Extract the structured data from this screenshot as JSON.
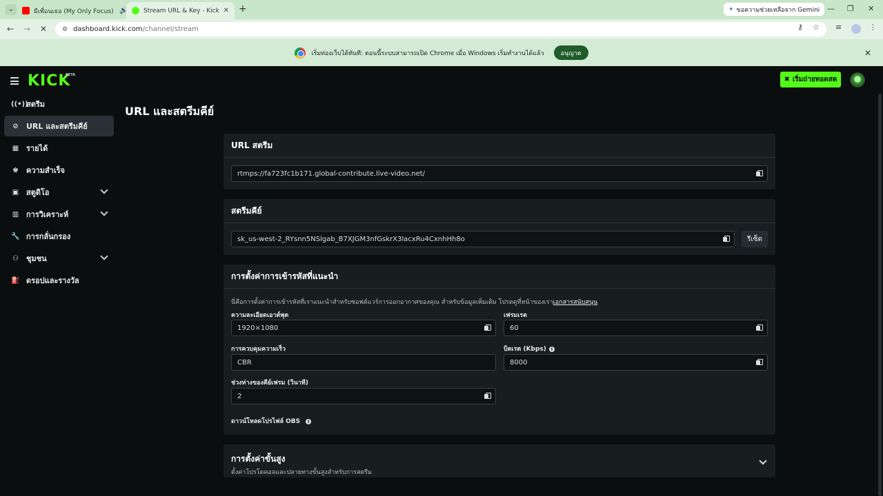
{
  "browser": {
    "tabs": [
      {
        "title": "มีเพื่อนเธอ (My Only Focus) O"
      },
      {
        "title": "Stream URL & Key - Kick Dashb"
      }
    ],
    "gemini_label": "ขอความช่วยเหลือจาก Gemini",
    "url_host": "dashboard.kick.com",
    "url_path": "/channel/stream",
    "infobar_text": "เริ่มท่องเว็บได้ทันที: ตอนนี้ระบบสามารถเปิด Chrome เมื่อ Windows เริ่มทำงานได้แล้ว",
    "infobar_button": "อนุญาต"
  },
  "app": {
    "logo": "KICK",
    "beta": "BETA",
    "go_live": "เริ่มถ่ายทอดสด"
  },
  "sidebar": {
    "items": [
      {
        "label": "สตรีม",
        "icon": "broadcast-icon"
      },
      {
        "label": "URL และสตรีมคีย์",
        "icon": "link-icon"
      },
      {
        "label": "รายได้",
        "icon": "revenue-icon"
      },
      {
        "label": "ความสำเร็จ",
        "icon": "trophy-icon"
      },
      {
        "label": "สตูดิโอ",
        "icon": "studio-icon"
      },
      {
        "label": "การวิเคราะห์",
        "icon": "analytics-icon"
      },
      {
        "label": "การกลั่นกรอง",
        "icon": "wrench-icon"
      },
      {
        "label": "ชุมชน",
        "icon": "community-icon"
      },
      {
        "label": "ดรอปและรางวัล",
        "icon": "drops-icon"
      }
    ]
  },
  "main": {
    "title": "URL และสตรีมคีย์",
    "stream_url": {
      "heading": "URL สตรีม",
      "value": "rtmps://fa723fc1b171.global-contribute.live-video.net/"
    },
    "stream_key": {
      "heading": "สตรีมคีย์",
      "value": "sk_us-west-2_RYsnn5NSlgab_B7XJGM3nfGskrX3lacxRu4CxnhHh8o",
      "reset": "รีเซ็ต"
    },
    "encoder": {
      "heading": "การตั้งค่าการเข้ารหัสที่แนะนำ",
      "description": "นี่คือการตั้งค่าการเข้ารหัสที่เราแนะนำสำหรับซอฟต์แวร์การออกอากาศของคุณ สำหรับข้อมูลเพิ่มเติม โปรดดูที่หน้าของเรา",
      "description_link": "เอกสารสนับสนุน",
      "resolution_label": "ความละเอียดเอาต์พุต",
      "resolution_value": "1920×1080",
      "framerate_label": "เฟรมเรต",
      "framerate_value": "60",
      "rate_control_label": "การควบคุมความเร็ว",
      "rate_control_value": "CBR",
      "bitrate_label": "บิตเรต (Kbps)",
      "bitrate_value": "8000",
      "keyframe_label": "ช่วงห่างของคีย์เฟรม (วินาที)",
      "keyframe_value": "2",
      "obs_profile": "ดาวน์โหลดโปรไฟล์ OBS"
    },
    "advanced": {
      "heading": "การตั้งค่าขั้นสูง",
      "subtitle": "ตั้งค่าโปรโตคอลและปลายทางขั้นสูงสำหรับการสตรีม"
    }
  }
}
